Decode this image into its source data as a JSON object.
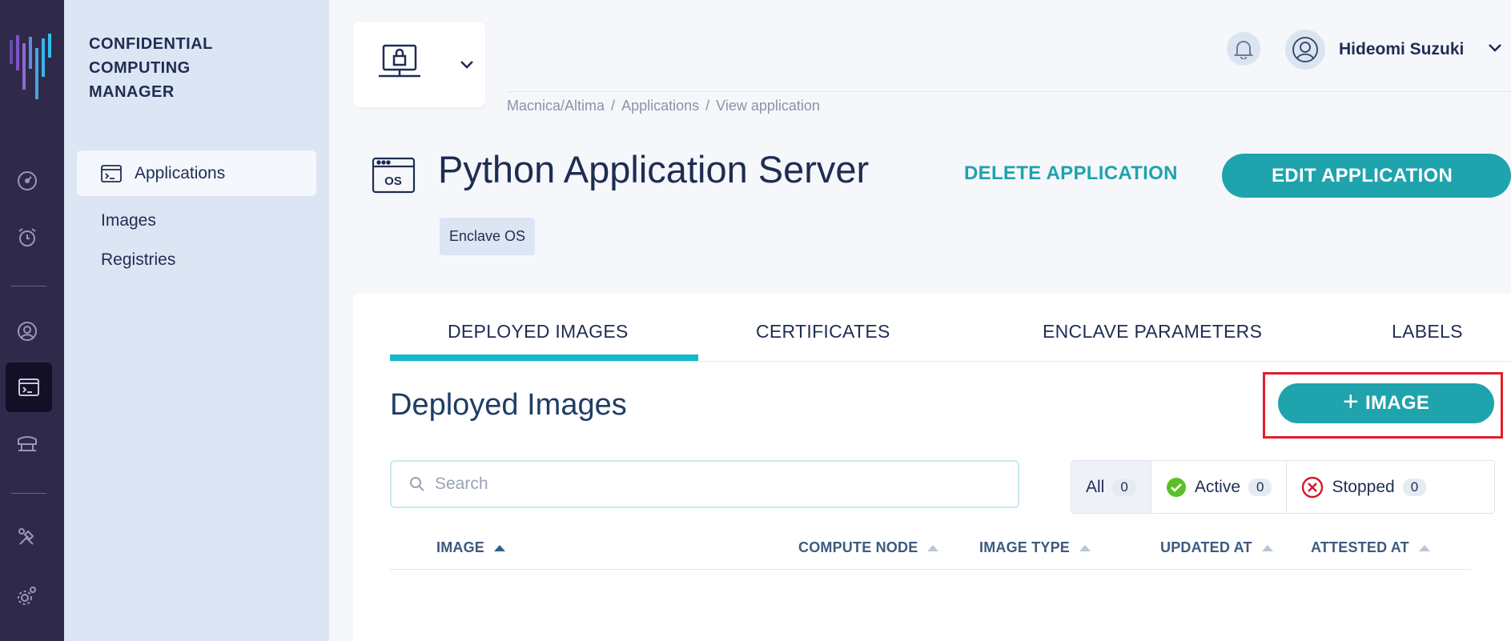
{
  "brand": {
    "line1": "CONFIDENTIAL",
    "line2": "COMPUTING",
    "line3": "MANAGER"
  },
  "sidebar": {
    "items": [
      {
        "label": "Applications",
        "active": true
      },
      {
        "label": "Images"
      },
      {
        "label": "Registries"
      }
    ]
  },
  "header": {
    "user_name": "Hideomi Suzuki"
  },
  "breadcrumb": [
    "Macnica/Altima",
    "Applications",
    "View application"
  ],
  "breadcrumb_sep": "/",
  "page": {
    "os_badge": "OS",
    "title": "Python Application Server",
    "delete_label": "DELETE APPLICATION",
    "edit_label": "EDIT APPLICATION",
    "tag": "Enclave OS"
  },
  "tabs": [
    "DEPLOYED IMAGES",
    "CERTIFICATES",
    "ENCLAVE PARAMETERS",
    "LABELS"
  ],
  "section": {
    "title": "Deployed Images",
    "add_label": "IMAGE",
    "search_placeholder": "Search"
  },
  "filters": [
    {
      "label": "All",
      "count": "0"
    },
    {
      "label": "Active",
      "count": "0"
    },
    {
      "label": "Stopped",
      "count": "0"
    }
  ],
  "table": {
    "columns": [
      "IMAGE",
      "COMPUTE NODE",
      "IMAGE TYPE",
      "UPDATED AT",
      "ATTESTED AT"
    ]
  },
  "colors": {
    "accent": "#1fa3ad",
    "rail": "#2f2a4a",
    "sidebar": "#dce5f3",
    "highlight": "#e11e2a",
    "active_status": "#5bbf2a",
    "stopped_status": "#d0182a"
  }
}
